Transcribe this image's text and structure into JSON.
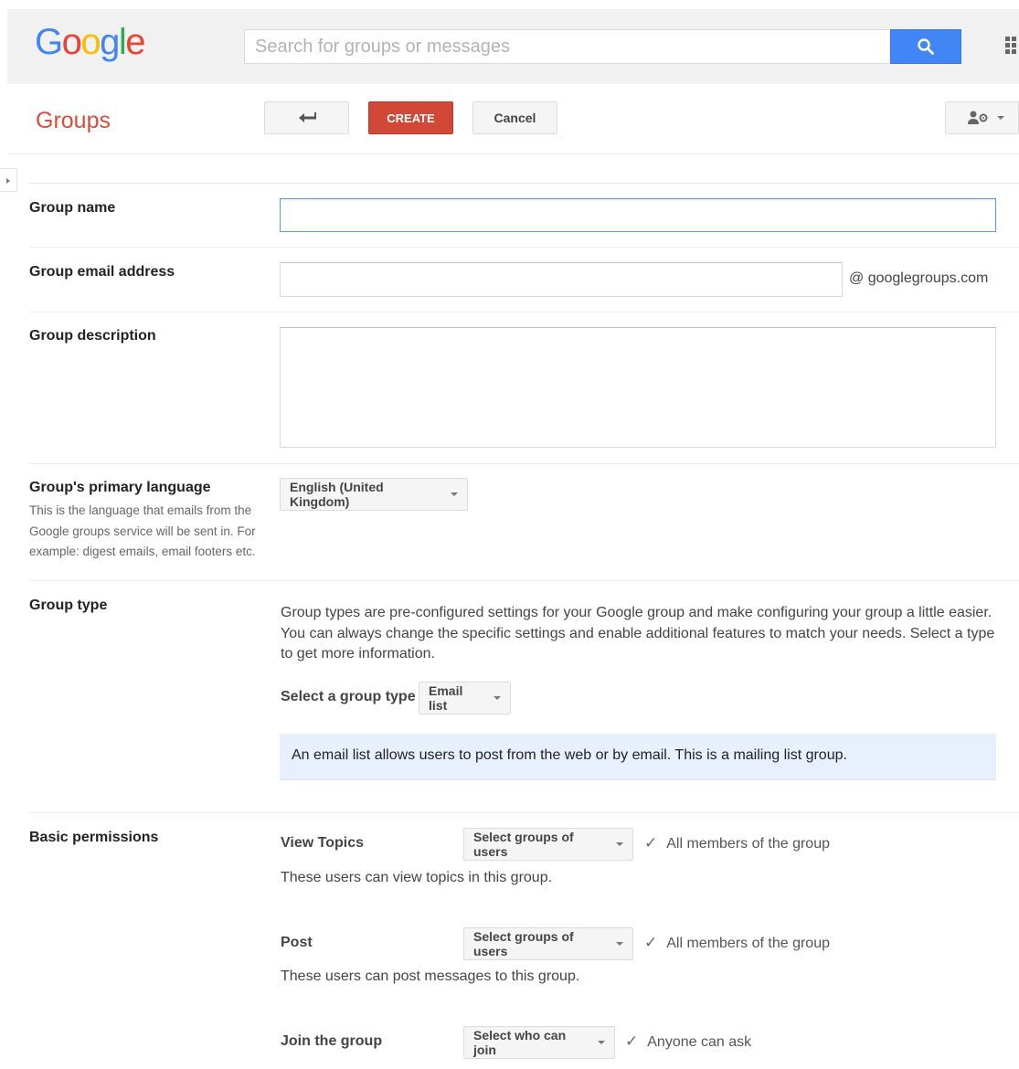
{
  "header": {
    "logo_letters": [
      {
        "ch": "G",
        "color": "#4285f4"
      },
      {
        "ch": "o",
        "color": "#ea4335"
      },
      {
        "ch": "o",
        "color": "#fbbc05"
      },
      {
        "ch": "g",
        "color": "#4285f4"
      },
      {
        "ch": "l",
        "color": "#34a853"
      },
      {
        "ch": "e",
        "color": "#ea4335"
      }
    ],
    "search_placeholder": "Search for groups or messages",
    "search_value": ""
  },
  "toolbar": {
    "title": "Groups",
    "create_label": "CREATE",
    "cancel_label": "Cancel"
  },
  "form": {
    "group_name": {
      "label": "Group name",
      "value": ""
    },
    "group_email": {
      "label": "Group email address",
      "value": "",
      "suffix": "@ googlegroups.com"
    },
    "group_description": {
      "label": "Group description",
      "value": ""
    },
    "language": {
      "label": "Group's primary language",
      "help": "This is the language that emails from the Google groups service will be sent in. For example: digest emails, email footers etc.",
      "selected": "English (United Kingdom)"
    },
    "group_type": {
      "label": "Group type",
      "description": "Group types are pre-configured settings for your Google group and make configuring your group a little easier. You can always change the specific settings and enable additional features to match your needs. Select a type to get more information.",
      "select_label": "Select a group type",
      "selected": "Email list",
      "info": "An email list allows users to post from the web or by email. This is a mailing list group."
    },
    "permissions": {
      "label": "Basic permissions",
      "view": {
        "label": "View Topics",
        "dropdown": "Select groups of users",
        "selected": "All members of the group",
        "help": "These users can view topics in this group."
      },
      "post": {
        "label": "Post",
        "dropdown": "Select groups of users",
        "selected": "All members of the group",
        "help": "These users can post messages to this group."
      },
      "join": {
        "label": "Join the group",
        "dropdown": "Select who can join",
        "selected": "Anyone can ask"
      }
    }
  },
  "icons": {
    "search": "search-icon",
    "apps": "apps-grid-icon",
    "back": "back-arrow-icon",
    "settings": "user-settings-icon",
    "check": "check-icon"
  },
  "colors": {
    "accent_blue": "#4285f4",
    "create_red": "#d14836",
    "groups_title": "#dd4b39",
    "info_bg": "#e8f0fe"
  }
}
